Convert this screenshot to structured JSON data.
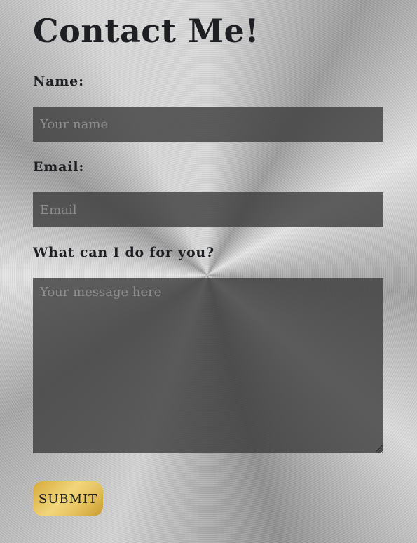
{
  "page": {
    "title": "Contact Me!"
  },
  "form": {
    "name_label": "Name:",
    "name_placeholder": "Your name",
    "name_value": "",
    "email_label": "Email:",
    "email_placeholder": "Email",
    "email_value": "",
    "message_label": "What can I do for you?",
    "message_placeholder": "Your message here",
    "message_value": "",
    "submit_label": "SUBMIT"
  },
  "colors": {
    "text": "#1e1f22",
    "input_background": "#3c3c3c",
    "placeholder": "#8e8e8e",
    "button_gold": "#e4c15e"
  }
}
